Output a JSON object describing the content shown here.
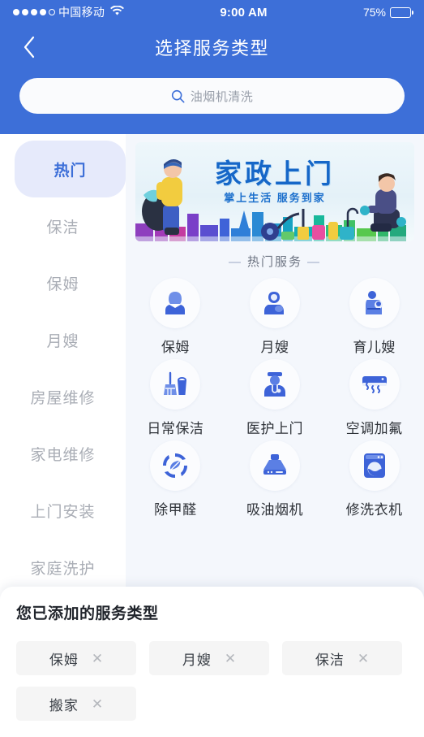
{
  "statusbar": {
    "carrier": "中国移动",
    "signal_dots_filled": 4,
    "signal_dots_total": 5,
    "wifi_icon": "wifi-icon",
    "time": "9:00 AM",
    "battery_label": "75%",
    "battery_percent": 75
  },
  "navbar": {
    "back_icon": "chevron-left-icon",
    "title": "选择服务类型"
  },
  "search": {
    "icon": "search-icon",
    "placeholder": "油烟机清洗",
    "value": ""
  },
  "sidebar": {
    "items": [
      {
        "label": "热门",
        "active": true
      },
      {
        "label": "保洁",
        "active": false
      },
      {
        "label": "保姆",
        "active": false
      },
      {
        "label": "月嫂",
        "active": false
      },
      {
        "label": "房屋维修",
        "active": false
      },
      {
        "label": "家电维修",
        "active": false
      },
      {
        "label": "上门安装",
        "active": false
      },
      {
        "label": "家庭洗护",
        "active": false
      }
    ]
  },
  "banner": {
    "title": "家政上门",
    "subtitle": "掌上生活  服务到家",
    "alt": "housekeeping-service-banner"
  },
  "section": {
    "dash_left": "—",
    "title": "热门服务",
    "dash_right": "—"
  },
  "services": [
    {
      "label": "保姆",
      "icon": "nanny-icon"
    },
    {
      "label": "月嫂",
      "icon": "maternity-nurse-icon"
    },
    {
      "label": "育儿嫂",
      "icon": "childcare-nurse-icon"
    },
    {
      "label": "日常保洁",
      "icon": "broom-bucket-icon"
    },
    {
      "label": "医护上门",
      "icon": "doctor-icon"
    },
    {
      "label": "空调加氟",
      "icon": "air-conditioner-icon"
    },
    {
      "label": "除甲醛",
      "icon": "formaldehyde-leaf-icon"
    },
    {
      "label": "吸油烟机",
      "icon": "range-hood-icon"
    },
    {
      "label": "修洗衣机",
      "icon": "washing-machine-icon"
    }
  ],
  "sheet": {
    "title": "您已添加的服务类型",
    "chips": [
      {
        "label": "保姆",
        "remove_icon": "close-icon"
      },
      {
        "label": "月嫂",
        "remove_icon": "close-icon"
      },
      {
        "label": "保洁",
        "remove_icon": "close-icon"
      },
      {
        "label": "搬家",
        "remove_icon": "close-icon"
      }
    ]
  },
  "colors": {
    "header_blue": "#3d6fd8",
    "accent_blue": "#4a7bea",
    "active_pill_bg": "#e6eafb",
    "content_bg": "#f4f7fc",
    "chip_bg": "#f5f5f5",
    "banner_title_blue": "#1667c8"
  }
}
